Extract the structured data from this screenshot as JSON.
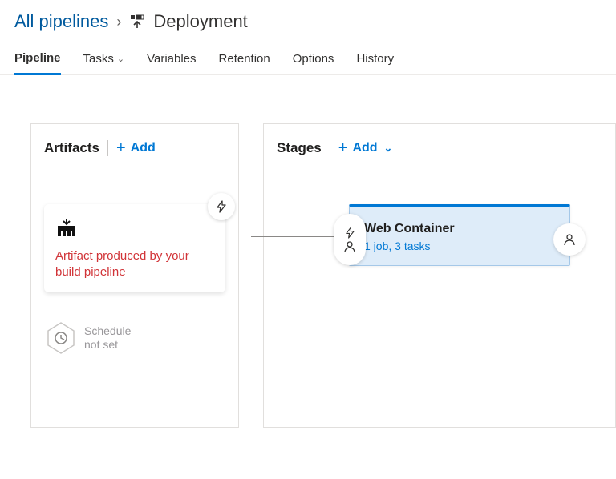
{
  "breadcrumb": {
    "root": "All pipelines",
    "current": "Deployment"
  },
  "tabs": {
    "pipeline": "Pipeline",
    "tasks": "Tasks",
    "variables": "Variables",
    "retention": "Retention",
    "options": "Options",
    "history": "History"
  },
  "artifacts": {
    "title": "Artifacts",
    "add_label": "Add",
    "card_text": "Artifact produced by your build pipeline",
    "schedule_text": "Schedule\nnot set"
  },
  "stages": {
    "title": "Stages",
    "add_label": "Add",
    "stage": {
      "name": "Web Container",
      "detail": "1 job, 3 tasks"
    }
  }
}
